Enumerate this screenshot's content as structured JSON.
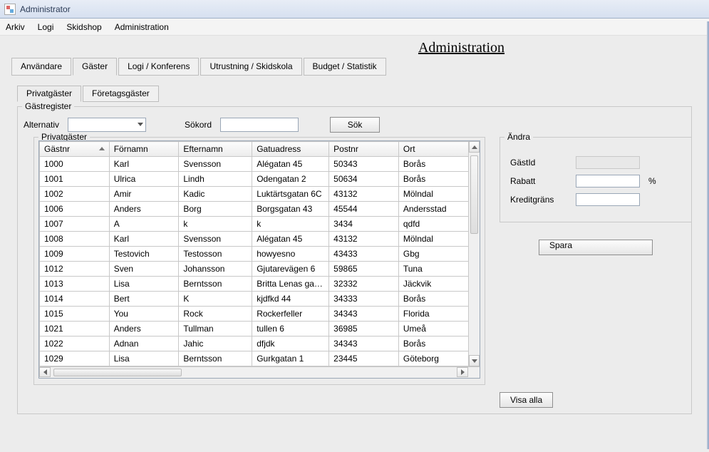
{
  "window": {
    "title": "Administrator"
  },
  "menubar": {
    "items": [
      "Arkiv",
      "Logi",
      "Skidshop",
      "Administration"
    ]
  },
  "page_heading": "Administration",
  "main_tabs": {
    "items": [
      "Användare",
      "Gäster",
      "Logi / Konferens",
      "Utrustning / Skidskola",
      "Budget / Statistik"
    ],
    "active_index": 1
  },
  "sub_tabs": {
    "items": [
      "Privatgäster",
      "Företagsgäster"
    ],
    "active_index": 0
  },
  "register": {
    "legend": "Gästregister",
    "alt_label": "Alternativ",
    "alt_value": "",
    "search_label": "Sökord",
    "search_value": "",
    "search_button": "Sök"
  },
  "grid": {
    "legend": "Privatgäster",
    "columns": [
      "Gästnr",
      "Förnamn",
      "Efternamn",
      "Gatuadress",
      "Postnr",
      "Ort"
    ],
    "sort_col_index": 0,
    "rows": [
      [
        "1000",
        "Karl",
        "Svensson",
        "Alégatan 45",
        "50343",
        "Borås"
      ],
      [
        "1001",
        "Ulrica",
        "Lindh",
        "Odengatan 2",
        "50634",
        "Borås"
      ],
      [
        "1002",
        "Amir",
        "Kadic",
        "Luktärtsgatan 6C",
        "43132",
        "Mölndal"
      ],
      [
        "1006",
        "Anders",
        "Borg",
        "Borgsgatan 43",
        "45544",
        "Andersstad"
      ],
      [
        "1007",
        "A",
        "k",
        "k",
        "3434",
        "qdfd"
      ],
      [
        "1008",
        "Karl",
        "Svensson",
        "Alégatan 45",
        "43132",
        "Mölndal"
      ],
      [
        "1009",
        "Testovich",
        "Testosson",
        "howyesno",
        "43433",
        "Gbg"
      ],
      [
        "1012",
        "Sven",
        "Johansson",
        "Gjutarevägen 6",
        "59865",
        "Tuna"
      ],
      [
        "1013",
        "Lisa",
        "Berntsson",
        "Britta Lenas gata...",
        "32332",
        "Jäckvik"
      ],
      [
        "1014",
        "Bert",
        "K",
        "kjdfkd 44",
        "34333",
        "Borås"
      ],
      [
        "1015",
        "You",
        "Rock",
        "Rockerfeller",
        "34343",
        "Florida"
      ],
      [
        "1021",
        "Anders",
        "Tullman",
        "tullen 6",
        "36985",
        "Umeå"
      ],
      [
        "1022",
        "Adnan",
        "Jahic",
        "dfjdk",
        "34343",
        "Borås"
      ],
      [
        "1029",
        "Lisa",
        "Berntsson",
        "Gurkgatan 1",
        "23445",
        "Göteborg"
      ]
    ]
  },
  "edit": {
    "legend": "Ändra",
    "gastid_label": "GästId",
    "rabatt_label": "Rabatt",
    "rabatt_suffix": "%",
    "kredit_label": "Kreditgräns",
    "rabatt_value": "",
    "kredit_value": "",
    "save_button": "Spara"
  },
  "show_all_button": "Visa alla"
}
